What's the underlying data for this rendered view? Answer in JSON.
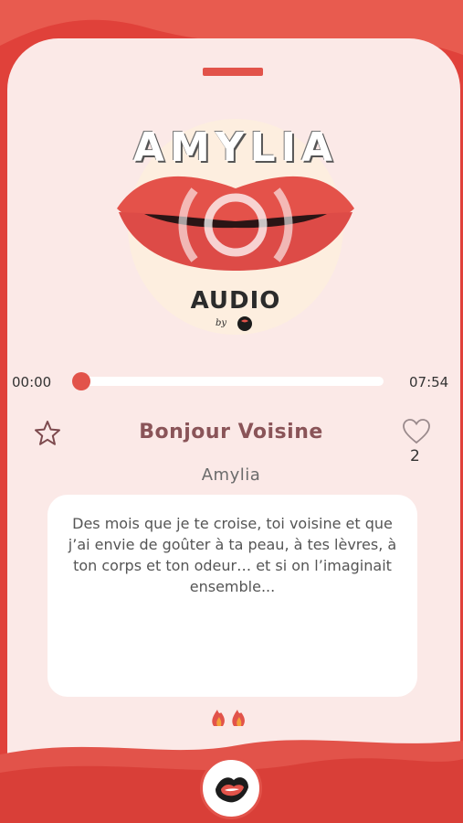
{
  "colors": {
    "accent": "#e2534a",
    "background": "#e0413a",
    "card": "#fbe9e7",
    "title": "#8a5458"
  },
  "logo": {
    "title": "AMYLIA",
    "subtitle": "AUDIO",
    "by": "by"
  },
  "player": {
    "current_time": "00:00",
    "total_time": "07:54",
    "progress": 0.0
  },
  "track": {
    "title": "Bonjour Voisine",
    "author": "Amylia",
    "likes": "2",
    "description": "Des mois que je te croise, toi voisine et que j’ai envie de goûter à ta peau, à tes lèvres, à ton corps et ton odeur… et si on l’imaginait ensemble..."
  },
  "icons": {
    "favorite": "star-icon",
    "like": "heart-icon",
    "intensity": "flame-icon",
    "play": "lips-icon"
  }
}
